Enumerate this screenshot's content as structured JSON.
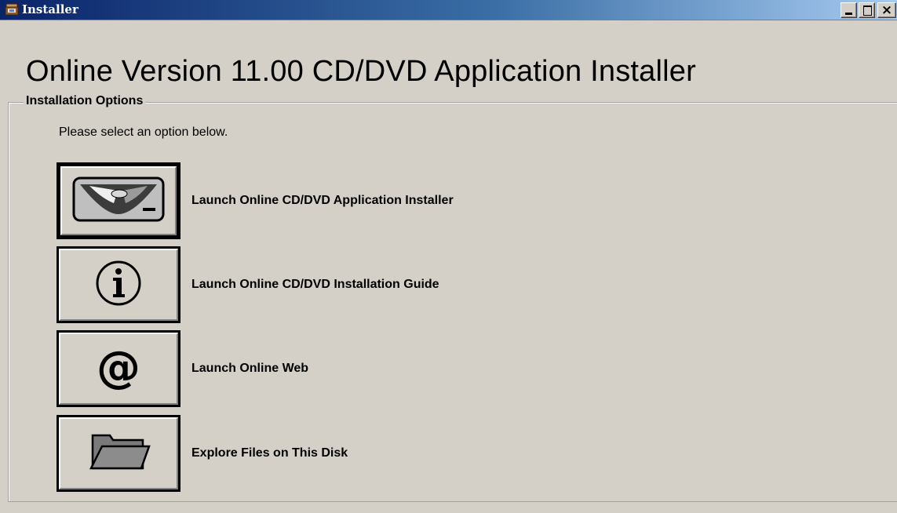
{
  "window": {
    "title": "Installer",
    "controls": {
      "minimize": "_",
      "maximize": "□",
      "close": "×"
    }
  },
  "main": {
    "heading": "Online Version 11.00 CD/DVD Application Installer",
    "group_label": "Installation Options",
    "instructions": "Please select an option below.",
    "options": [
      {
        "label": "Launch Online CD/DVD Application Installer",
        "icon": "cd-drive-icon"
      },
      {
        "label": "Launch Online CD/DVD Installation Guide",
        "icon": "info-icon"
      },
      {
        "label": "Launch Online Web",
        "icon": "at-sign-icon"
      },
      {
        "label": "Explore Files on This Disk",
        "icon": "folder-icon"
      }
    ]
  },
  "colors": {
    "face": "#d4d0c8",
    "titlebar_start": "#0a246a",
    "titlebar_end": "#a6caf0"
  }
}
